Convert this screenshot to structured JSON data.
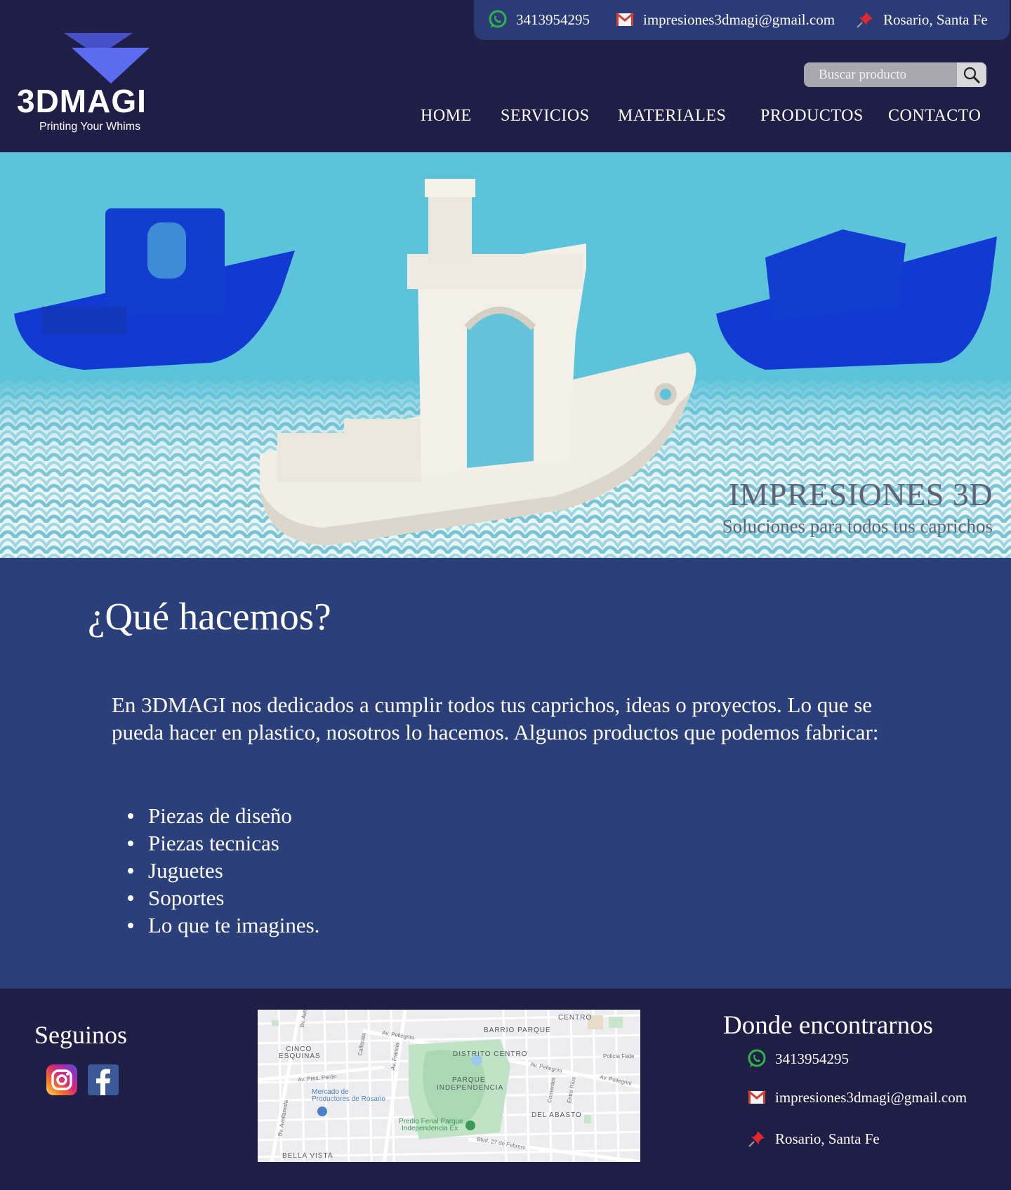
{
  "contact": {
    "phone": "3413954295",
    "email": "impresiones3dmagi@gmail.com",
    "location": "Rosario, Santa Fe"
  },
  "brand": {
    "name": "3DMAGI",
    "tagline": "Printing Your Whims"
  },
  "search": {
    "placeholder": "Buscar producto"
  },
  "nav": {
    "items": [
      {
        "label": "HOME"
      },
      {
        "label": "SERVICIOS"
      },
      {
        "label": "MATERIALES"
      },
      {
        "label": "PRODUCTOS"
      },
      {
        "label": "CONTACTO"
      }
    ]
  },
  "hero": {
    "title": "IMPRESIONES 3D",
    "subtitle": "Soluciones para todos tus caprichos"
  },
  "about": {
    "heading": "¿Qué hacemos?",
    "paragraph": "En 3DMAGI nos dedicados a cumplir todos tus caprichos, ideas o proyectos. Lo que se pueda hacer en plastico, nosotros lo hacemos. Algunos productos que podemos fabricar:",
    "items": [
      "Piezas de diseño",
      "Piezas tecnicas",
      "Juguetes",
      "Soportes",
      "Lo que te imagines."
    ]
  },
  "footer": {
    "follow_title": "Seguinos",
    "where_title": "Donde encontrarnos",
    "social": [
      "instagram-icon",
      "facebook-icon"
    ]
  },
  "map": {
    "labels": {
      "centro": "CENTRO",
      "barrio_parque": "BARRIO PARQUE",
      "cinco": "CINCO",
      "esquinas": "ESQUINAS",
      "distrito_centro": "DISTRITO CENTRO",
      "parque": "PARQUE",
      "independencia": "INDEPENDENCIA",
      "del_abasto": "DEL ABASTO",
      "bella_vista": "BELLA VISTA",
      "policia": "Policía Fede",
      "mercado_1": "Mercado de",
      "mercado_2": "Productores de Rosario",
      "predio_1": "Predio Ferial Parque",
      "predio_2": "Independencia Ex",
      "av_pellegrini_1": "Av. Pellegrini",
      "av_pellegrini_2": "Av. Pellegrini",
      "av_pellegrini_3": "Av. Pellegrini",
      "av_peron": "Av. Pres. Perón",
      "av_francia": "Av. Francia",
      "cafferata": "Cafferata",
      "corrientes": "Corrientes",
      "entre_rios": "Entre Ríos",
      "bv_27": "Blvd. 27 de Febrero",
      "bv_avellaneda": "Bv. Avellaneda",
      "bv_av": "Bv. Ave"
    }
  },
  "colors": {
    "header_bg": "#1f1e47",
    "contact_bar": "#2a3b78",
    "section_bg": "#2b3f7a",
    "hero_text": "#5e6478"
  }
}
